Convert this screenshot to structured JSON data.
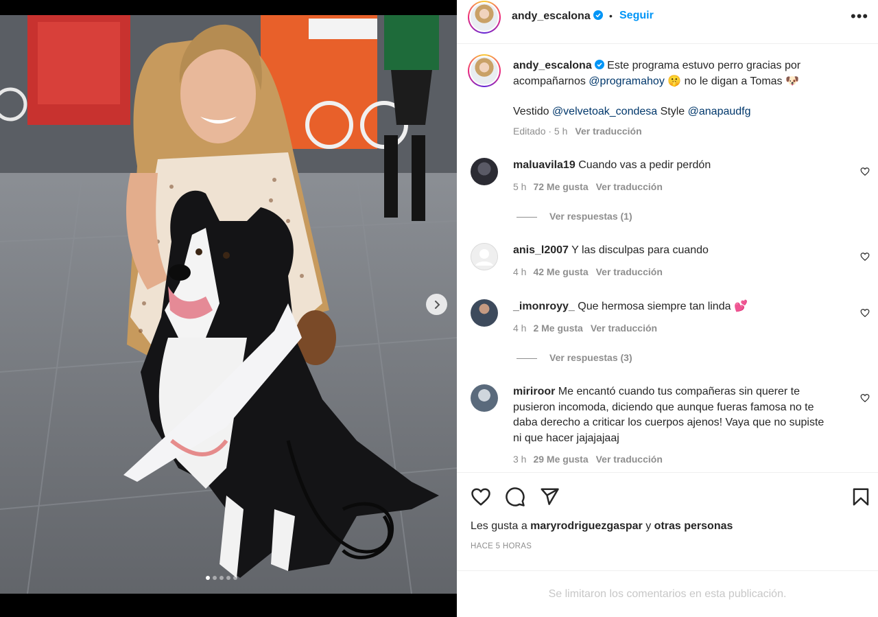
{
  "post": {
    "author": "andy_escalona",
    "follow_label": "Seguir",
    "separator": "•",
    "more_label": "•••",
    "carousel": {
      "slides": 5,
      "active_index": 0
    }
  },
  "caption": {
    "username": "andy_escalona",
    "text_1": " Este programa estuvo perro gracias por acompañarnos ",
    "mention_1": "@programahoy",
    "text_2": " 🤫 no le digan a Tomas 🐶",
    "line2_prefix": "Vestido ",
    "mention_2": "@velvetoak_condesa",
    "line2_mid": " Style ",
    "mention_3": "@anapaudfg",
    "meta_time": "Editado · 5 h",
    "meta_translate": "Ver traducción"
  },
  "comments": [
    {
      "username": "maluavila19",
      "text": "Cuando vas a pedir perdón",
      "time": "5 h",
      "likes": "72 Me gusta",
      "translate": "Ver traducción",
      "replies": "Ver respuestas (1)"
    },
    {
      "username": "anis_l2007",
      "text": "Y las disculpas para cuando",
      "time": "4 h",
      "likes": "42 Me gusta",
      "translate": "Ver traducción",
      "replies": ""
    },
    {
      "username": "_imonroyy_",
      "text": "Que hermosa siempre tan linda 💕",
      "time": "4 h",
      "likes": "2 Me gusta",
      "translate": "Ver traducción",
      "replies": "Ver respuestas (3)"
    },
    {
      "username": "miriroor",
      "text": "Me encantó cuando tus compañeras sin querer te pusieron incomoda, diciendo que aunque fueras famosa no te daba derecho a criticar los cuerpos ajenos! Vaya que no supiste ni que hacer jajajajaaj",
      "time": "3 h",
      "likes": "29 Me gusta",
      "translate": "Ver traducción",
      "replies": ""
    }
  ],
  "likes": {
    "prefix": "Les gusta a ",
    "user": "maryrodriguezgaspar",
    "and": " y ",
    "others": "otras personas"
  },
  "posted": "HACE 5 HORAS",
  "footer": "Se limitaron los comentarios en esta publicación.",
  "colors": {
    "link": "#0095f6",
    "mention": "#00376b",
    "muted": "#8e8e8e",
    "text": "#262626"
  }
}
